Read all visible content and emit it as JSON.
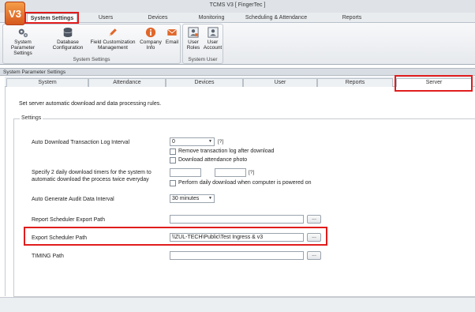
{
  "window": {
    "title": "TCMS V3 [ FingerTec ]",
    "logo_text": "V3"
  },
  "ribbon_tabs": [
    "System Settings",
    "Users",
    "Devices",
    "Monitoring",
    "Scheduling & Attendance",
    "Reports"
  ],
  "ribbon": {
    "group1": {
      "label": "System Settings",
      "buttons": [
        {
          "line1": "System Parameter",
          "line2": "Settings",
          "icon": "gears-icon"
        },
        {
          "line1": "Database",
          "line2": "Configuration",
          "icon": "database-icon"
        },
        {
          "line1": "Field Customization",
          "line2": "Management",
          "icon": "pencil-icon"
        },
        {
          "line1": "Company",
          "line2": "Info",
          "icon": "info-icon"
        },
        {
          "line1": "Email",
          "line2": "",
          "icon": "email-icon"
        }
      ]
    },
    "group2": {
      "label": "System User",
      "buttons": [
        {
          "line1": "User",
          "line2": "Roles",
          "icon": "user-roles-icon"
        },
        {
          "line1": "User",
          "line2": "Account",
          "icon": "user-account-icon"
        }
      ]
    }
  },
  "panel_title": "System Parameter Settings",
  "content_tabs": [
    "System",
    "Attendance",
    "Devices",
    "User",
    "Reports",
    "Server"
  ],
  "active_content_tab": "Server",
  "description": "Set server automatic download and data processing rules.",
  "settings": {
    "legend": "Settings",
    "auto_download_label": "Auto Download Transaction Log Interval",
    "auto_download_value": "0",
    "help_mark": "[?]",
    "remove_log_label": "Remove transaction log after download",
    "download_photo_label": "Download attendance photo",
    "timers_label_line1": "Specify 2 daily download timers for the system to",
    "timers_label_line2": "automatic download the process twice everyday",
    "timer1_value": "",
    "timer2_value": "",
    "perform_daily_label": "Perform daily download when computer is powered on",
    "audit_label": "Auto Generate Audit Data Interval",
    "audit_value": "30 minutes",
    "report_export_label": "Report Scheduler Export Path",
    "report_export_value": "",
    "export_path_label": "Export Scheduler Path",
    "export_path_value": "\\\\ZUL-TECH\\Public\\Test Ingress & v3",
    "timing_label": "TIMING Path",
    "timing_value": "",
    "browse_label": "..."
  },
  "colors": {
    "highlight": "#e11d1d",
    "logo": "#e0672a"
  }
}
